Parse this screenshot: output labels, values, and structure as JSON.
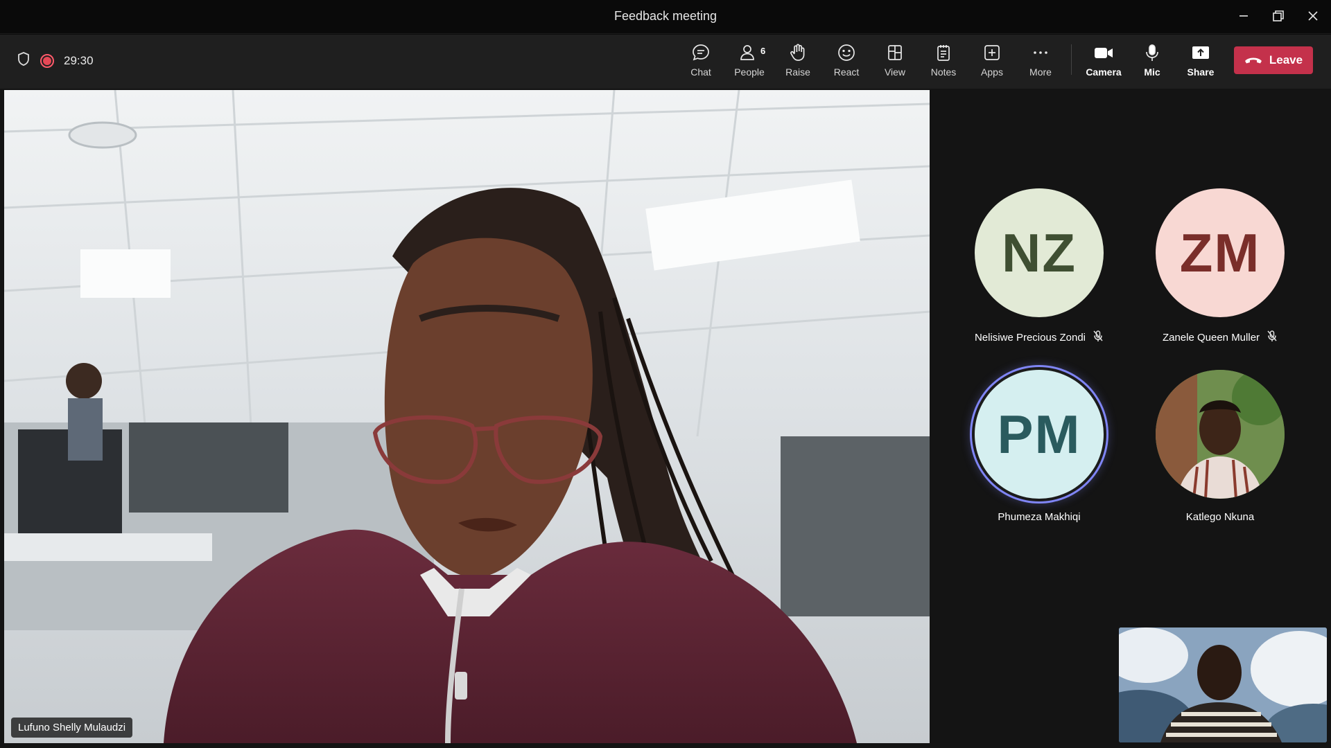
{
  "window": {
    "title": "Feedback meeting"
  },
  "status": {
    "timer": "29:30"
  },
  "toolbar": {
    "chat": "Chat",
    "people": "People",
    "people_count": "6",
    "raise": "Raise",
    "react": "React",
    "view": "View",
    "notes": "Notes",
    "apps": "Apps",
    "more": "More",
    "camera": "Camera",
    "mic": "Mic",
    "share": "Share",
    "leave": "Leave"
  },
  "main_video": {
    "name": "Lufuno Shelly Mulaudzi"
  },
  "participants": [
    {
      "initials": "NZ",
      "name": "Nelisiwe Precious Zondi",
      "muted": true,
      "bg": "#e2ead6",
      "fg": "#3f4f32"
    },
    {
      "initials": "ZM",
      "name": "Zanele Queen Muller",
      "muted": true,
      "bg": "#f8d8d3",
      "fg": "#7a2e2a"
    },
    {
      "initials": "PM",
      "name": "Phumeza Makhiqi",
      "muted": false,
      "speaking": true,
      "bg": "#d5eff0",
      "fg": "#2a5b5e"
    },
    {
      "initials": "",
      "name": "Katlego Nkuna",
      "muted": false,
      "photo": true
    }
  ],
  "colors": {
    "leave": "#c4314b",
    "speaking_ring": "#7f85f5",
    "recording": "#e74856"
  }
}
